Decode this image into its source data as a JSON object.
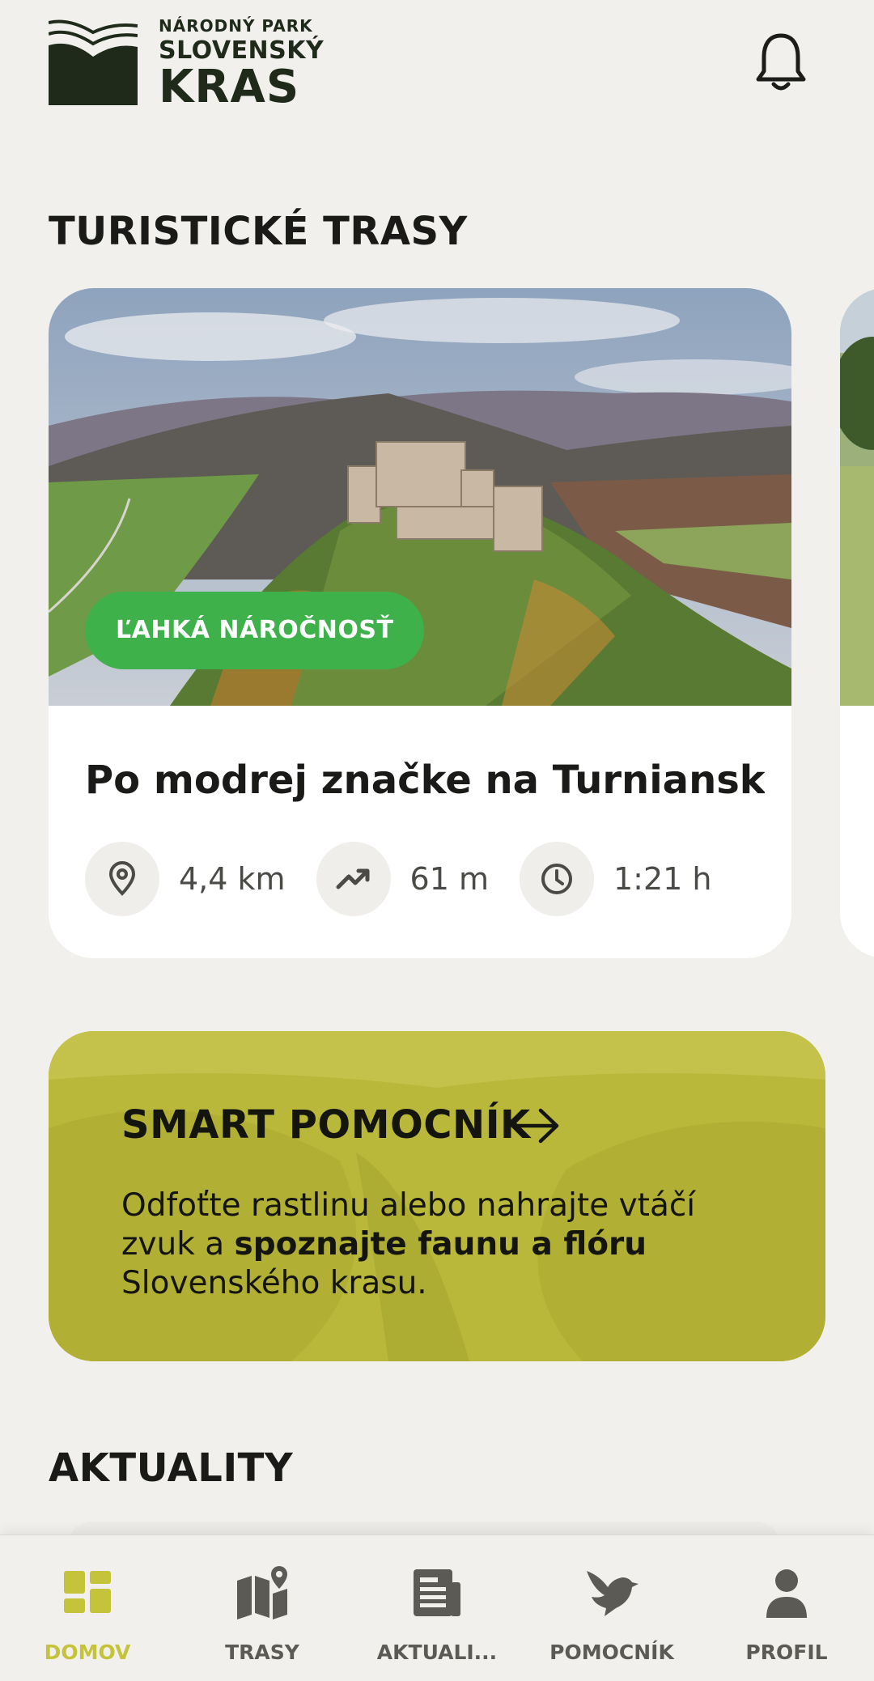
{
  "header": {
    "logo_line1": "NÁRODNÝ PARK",
    "logo_line2": "SLOVENSKÝ",
    "logo_line3": "KRAS",
    "notification_icon": "bell-icon"
  },
  "routes": {
    "title": "TURISTICKÉ TRASY",
    "cards": [
      {
        "badge": "ĽAHKÁ NÁROČNOSŤ",
        "title": "Po modrej značke na Turniansk...",
        "distance": "4,4 km",
        "elevation": "61 m",
        "duration": "1:21 h"
      }
    ]
  },
  "helper": {
    "title": "SMART POMOCNÍK",
    "text_before": "Odfoťte rastlinu alebo nahrajte vtáčí zvuk a ",
    "text_bold": "spoznajte faunu a flóru",
    "text_after": " Slovenského krasu."
  },
  "news": {
    "title": "AKTUALITY"
  },
  "nav": {
    "items": [
      {
        "label": "DOMOV",
        "icon": "dashboard-icon",
        "active": true
      },
      {
        "label": "TRASY",
        "icon": "map-icon"
      },
      {
        "label": "AKTUALI...",
        "icon": "news-icon"
      },
      {
        "label": "POMOCNÍK",
        "icon": "bird-icon"
      },
      {
        "label": "PROFIL",
        "icon": "person-icon"
      }
    ],
    "active_color": "#c4c33a",
    "inactive_color": "#5b5a55"
  },
  "colors": {
    "background": "#f1f0ed",
    "badge_green": "#3fb14b",
    "helper_olive": "#b9b83a"
  }
}
